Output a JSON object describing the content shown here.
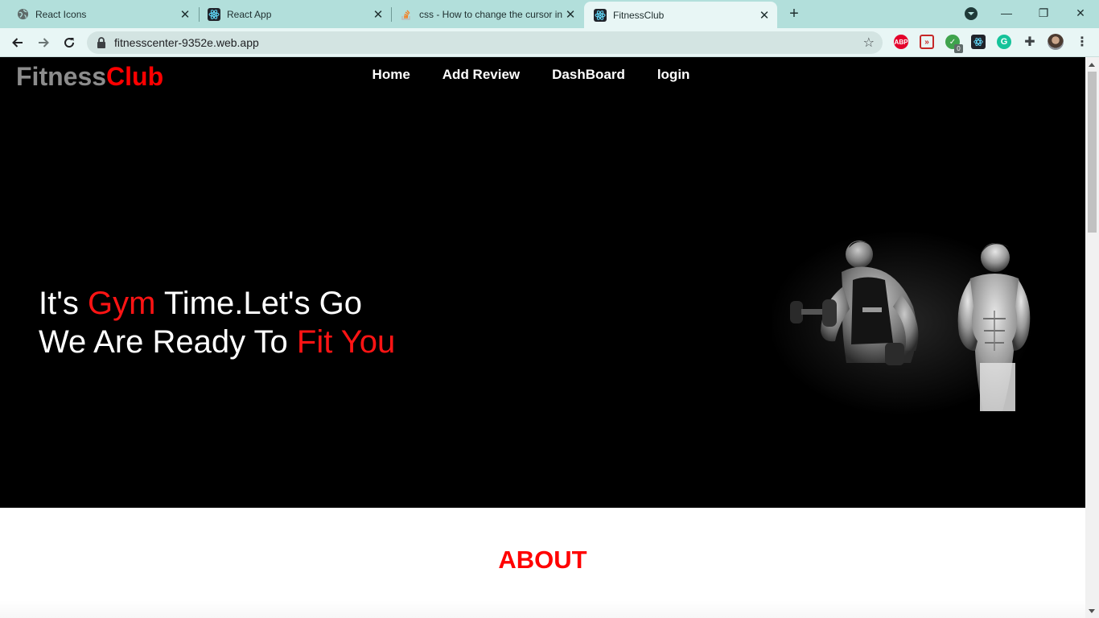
{
  "browser": {
    "tabs": [
      {
        "title": "React Icons",
        "icon": "globe-icon",
        "active": false
      },
      {
        "title": "React App",
        "icon": "react-icon",
        "active": false
      },
      {
        "title": "css - How to change the cursor in",
        "icon": "stackoverflow-icon",
        "active": false
      },
      {
        "title": "FitnessClub",
        "icon": "react-icon",
        "active": true
      }
    ],
    "new_tab_label": "+",
    "url": "fitnesscenter-9352e.web.app",
    "window_controls": {
      "minimize": "—",
      "restore": "❐",
      "close": "✕"
    },
    "extensions": [
      {
        "name": "adblock-plus-icon",
        "label": "ABP",
        "color": "#e4002b"
      },
      {
        "name": "video-ext-icon",
        "label": "",
        "color": "#c62828"
      },
      {
        "name": "shield-check-icon",
        "label": "0",
        "color": "#3fa34d"
      },
      {
        "name": "react-devtools-icon",
        "label": "",
        "color": "#20232a"
      },
      {
        "name": "grammarly-icon",
        "label": "G",
        "color": "#15c39a"
      },
      {
        "name": "puzzle-icon",
        "label": "",
        "color": "#3c4043"
      }
    ]
  },
  "site": {
    "brand_part1": "Fitness",
    "brand_part2": "Club",
    "nav": [
      "Home",
      "Add Review",
      "DashBoard",
      "login"
    ],
    "hero": {
      "line1_a": "It's ",
      "line1_b": "Gym",
      "line1_c": " Time.Let's Go",
      "line2_a": "We Are Ready To ",
      "line2_b": "Fit You"
    },
    "about_heading": "ABOUT"
  },
  "colors": {
    "accent": "#ff0000",
    "brand_grey": "#8c8c8c",
    "hero_bg": "#000000",
    "tabstrip": "#b2dfdb"
  }
}
